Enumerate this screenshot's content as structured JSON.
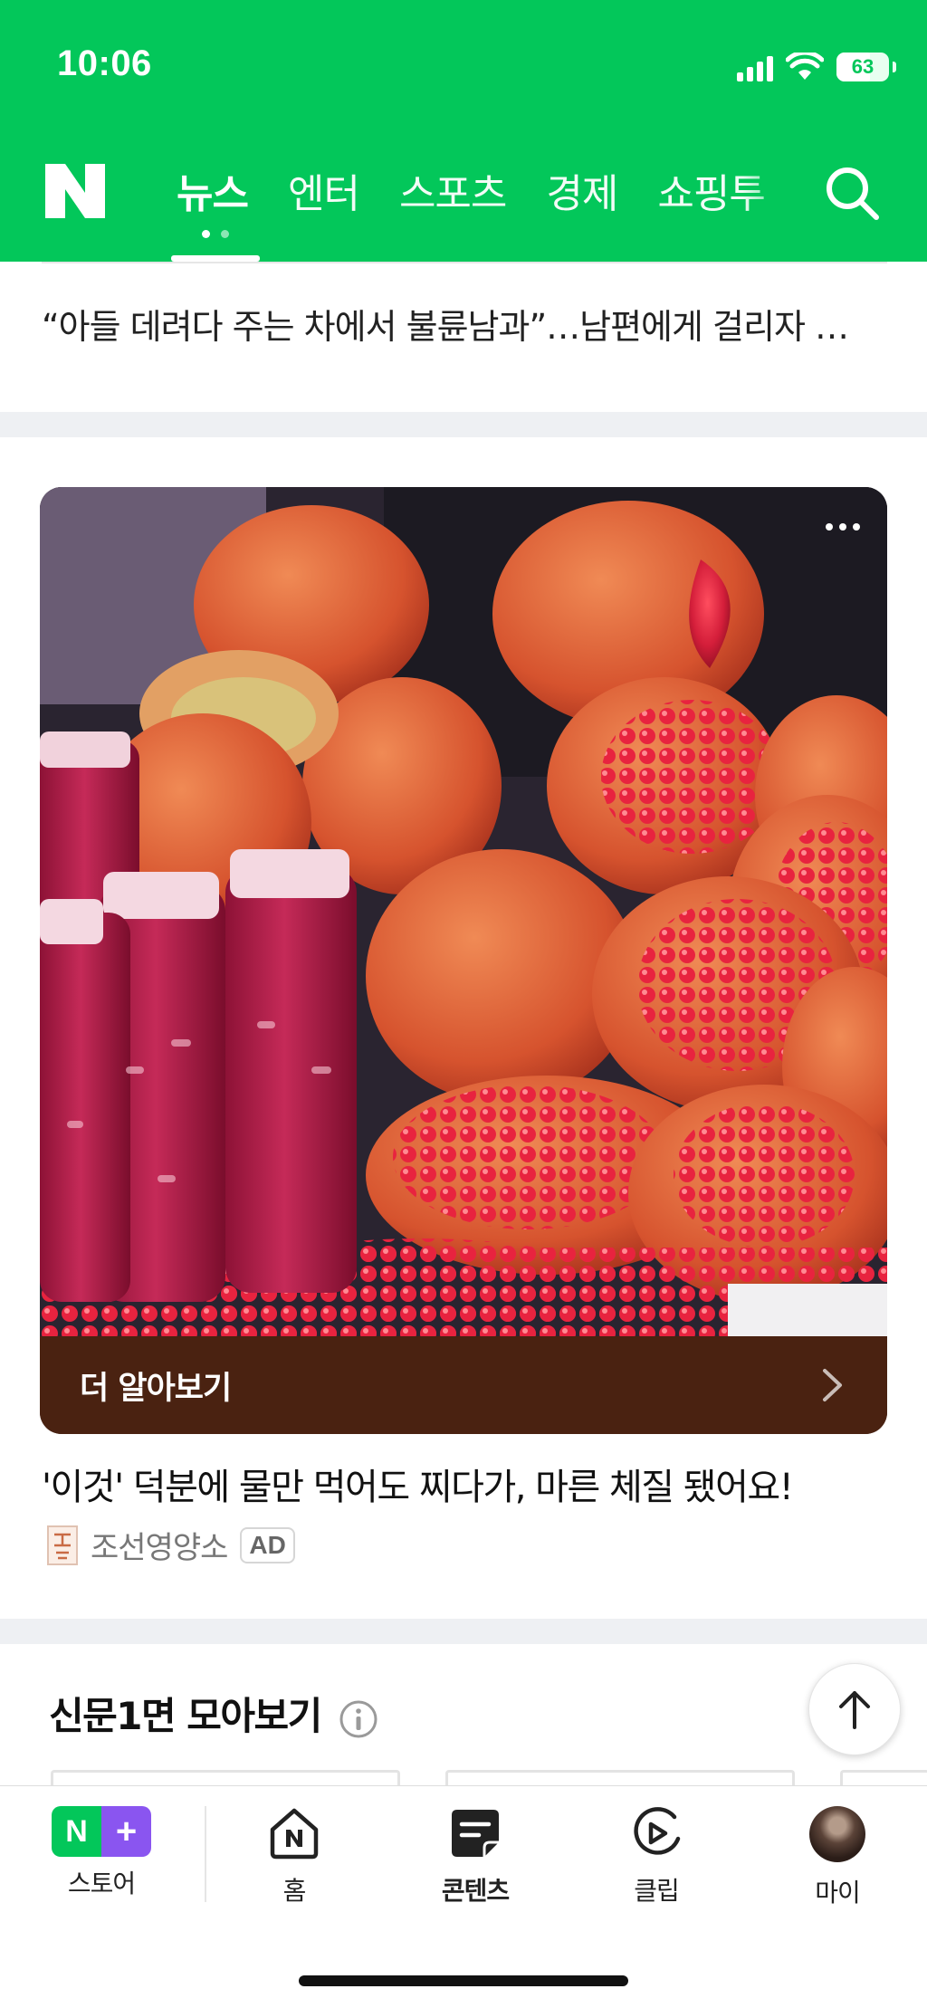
{
  "status_bar": {
    "time": "10:06",
    "battery": "63"
  },
  "header": {
    "logo": "N",
    "tabs": [
      {
        "label": "뉴스",
        "active": true
      },
      {
        "label": "엔터",
        "active": false
      },
      {
        "label": "스포츠",
        "active": false
      },
      {
        "label": "경제",
        "active": false
      },
      {
        "label": "쇼핑투",
        "active": false
      }
    ],
    "search_icon": "search-icon"
  },
  "feed": {
    "headline": "“아들 데려다 주는 차에서 불륜남과”…남편에게 걸리자 …",
    "ad": {
      "cta_label": "더 알아보기",
      "title": "'이것' 덕분에 물만 먹어도 찌다가, 마른 체질 됐어요!",
      "advertiser": "조선영양소",
      "badge": "AD"
    },
    "section": {
      "title": "신문1면 모아보기"
    }
  },
  "bottom_nav": {
    "items": [
      {
        "label": "스토어",
        "icon": "store-icon",
        "badge_left": "N",
        "badge_right": "+"
      },
      {
        "label": "홈",
        "icon": "home-icon"
      },
      {
        "label": "콘텐츠",
        "icon": "contents-icon",
        "active": true
      },
      {
        "label": "클립",
        "icon": "clip-icon"
      },
      {
        "label": "마이",
        "icon": "avatar"
      }
    ]
  },
  "colors": {
    "brand_green": "#03c75a",
    "cta_brown": "#4a2211",
    "store_purple": "#8a55f0"
  }
}
